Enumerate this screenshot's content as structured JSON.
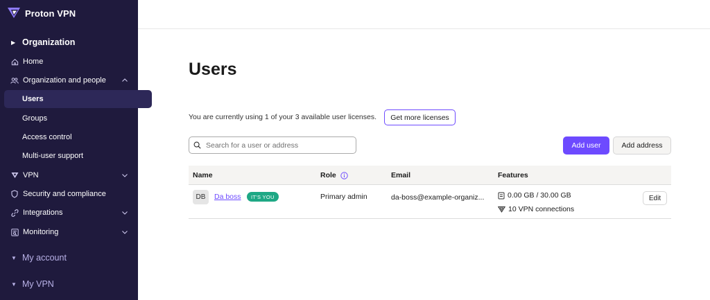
{
  "app": {
    "brand": "Proton VPN",
    "accent": "#6d4aff",
    "sidebar_bg": "#1f1a3d"
  },
  "sidebar": {
    "organization_section": "Organization",
    "items": [
      {
        "label": "Home",
        "icon": "home-icon"
      },
      {
        "label": "Organization and people",
        "icon": "people-icon",
        "expanded": true
      },
      {
        "label": "Users",
        "active": true
      },
      {
        "label": "Groups"
      },
      {
        "label": "Access control"
      },
      {
        "label": "Multi-user support"
      },
      {
        "label": "VPN",
        "icon": "vpn-icon"
      },
      {
        "label": "Security and compliance",
        "icon": "shield-icon"
      },
      {
        "label": "Integrations",
        "icon": "link-icon"
      },
      {
        "label": "Monitoring",
        "icon": "monitoring-icon"
      }
    ],
    "my_account_section": "My account",
    "my_vpn_section": "My VPN"
  },
  "main": {
    "title": "Users",
    "license_text": "You are currently using 1 of your 3 available user licenses.",
    "get_more_licenses": "Get more licenses",
    "search_placeholder": "Search for a user or address",
    "add_user": "Add user",
    "add_address": "Add address",
    "table": {
      "headers": {
        "name": "Name",
        "role": "Role",
        "email": "Email",
        "features": "Features"
      },
      "rows": [
        {
          "initials": "DB",
          "name": "Da boss",
          "badge": "IT'S YOU",
          "role": "Primary admin",
          "email": "da-boss@example-organiz...",
          "storage": "0.00 GB / 30.00 GB",
          "vpn": "10 VPN connections",
          "edit": "Edit"
        }
      ]
    }
  }
}
